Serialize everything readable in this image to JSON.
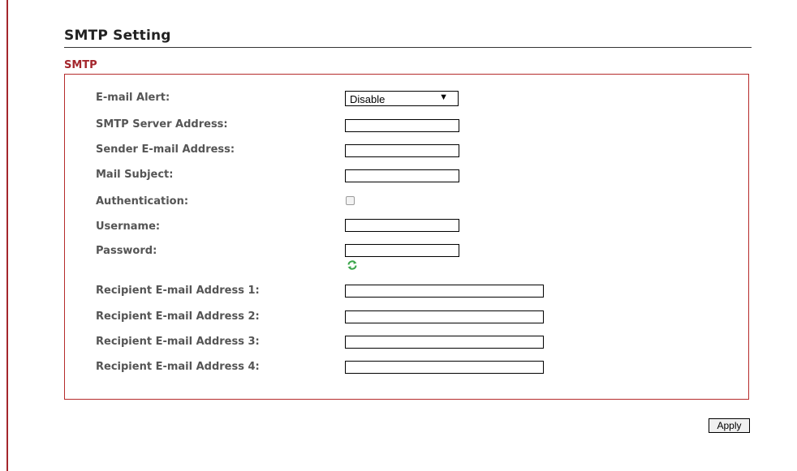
{
  "page": {
    "title": "SMTP Setting",
    "section": "SMTP"
  },
  "form": {
    "email_alert": {
      "label": "E-mail Alert:",
      "value": "Disable",
      "arrow": "▼"
    },
    "smtp_server": {
      "label": "SMTP Server Address:",
      "value": ""
    },
    "sender_email": {
      "label": "Sender E-mail Address:",
      "value": ""
    },
    "mail_subject": {
      "label": "Mail Subject:",
      "value": ""
    },
    "authentication": {
      "label": "Authentication:",
      "checked": false
    },
    "username": {
      "label": "Username:",
      "value": ""
    },
    "password": {
      "label": "Password:",
      "value": "",
      "icon": "refresh-icon"
    },
    "recipients": [
      {
        "label": "Recipient E-mail Address 1:",
        "value": ""
      },
      {
        "label": "Recipient E-mail Address 2:",
        "value": ""
      },
      {
        "label": "Recipient E-mail Address 3:",
        "value": ""
      },
      {
        "label": "Recipient E-mail Address 4:",
        "value": ""
      }
    ]
  },
  "actions": {
    "apply_label": "Apply"
  },
  "colors": {
    "accent": "#a4262c",
    "label": "#555555",
    "icon": "#3aa54a"
  }
}
